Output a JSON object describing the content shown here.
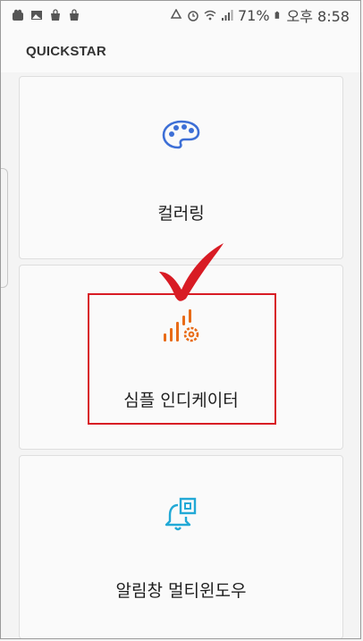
{
  "status_bar": {
    "notification_icons": [
      "store-icon",
      "image-icon",
      "shopping-bag-icon",
      "shopping-bag-icon"
    ],
    "battery": "71%",
    "time": "오후 8:58"
  },
  "app_bar": {
    "title": "QUICKSTAR"
  },
  "cards": [
    {
      "label": "컬러링",
      "icon": "palette-icon",
      "icon_color": "#3d6fd6"
    },
    {
      "label": "심플 인디케이터",
      "icon": "signal-gear-icon",
      "icon_color": "#e86b17"
    },
    {
      "label": "알림창 멀티윈도우",
      "icon": "bell-window-icon",
      "icon_color": "#22a9d6"
    }
  ],
  "annotation": {
    "highlight_color": "#d81b24"
  }
}
